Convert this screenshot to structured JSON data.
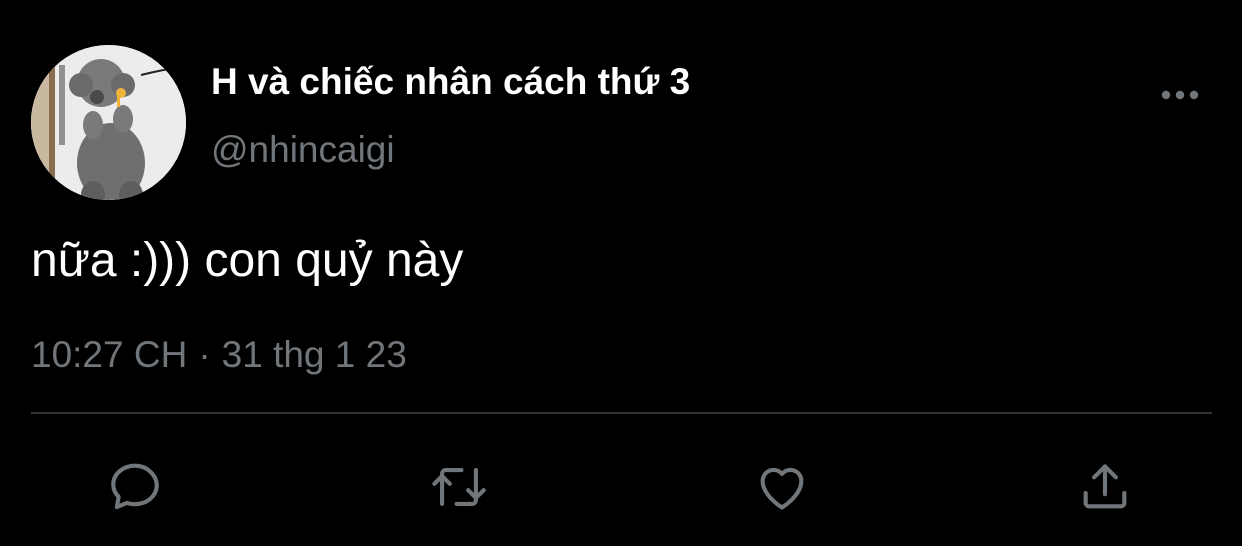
{
  "tweet": {
    "display_name": "H và chiếc nhân cách thứ 3",
    "handle": "@nhincaigi",
    "text": "nữa :))) con quỷ này",
    "time": "10:27 CH",
    "separator": "·",
    "date": "31 thg 1 23"
  },
  "icons": {
    "more": "more-horizontal-icon",
    "reply": "reply-icon",
    "retweet": "retweet-icon",
    "like": "heart-icon",
    "share": "share-icon"
  },
  "colors": {
    "background": "#000000",
    "primary_text": "#ffffff",
    "secondary_text": "#71767b",
    "divider": "#2f3336",
    "icon": "#71767b"
  }
}
